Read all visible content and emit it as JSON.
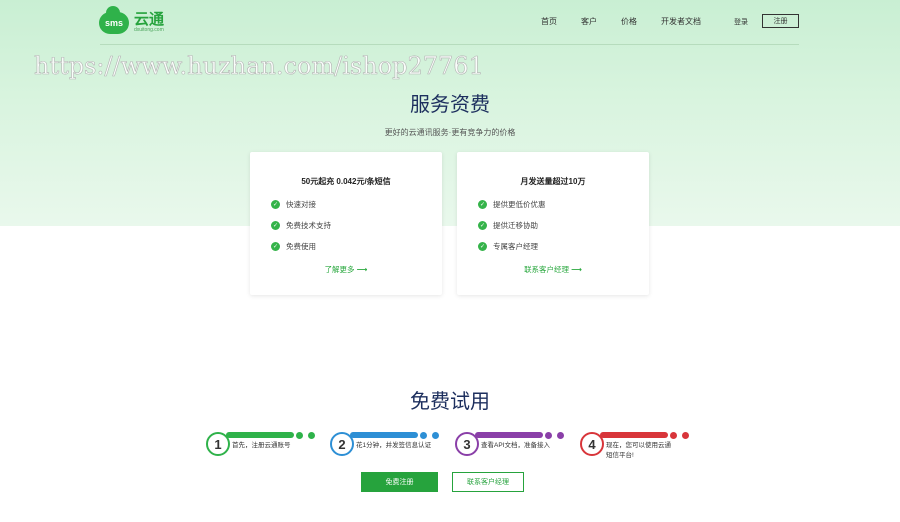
{
  "header": {
    "logo_badge": "sms",
    "logo_name": "云通",
    "logo_sub": "dxuitong.com",
    "nav": [
      "首页",
      "客户",
      "价格",
      "开发者文档"
    ],
    "login": "登录",
    "register": "注册"
  },
  "watermark": "https://www.huzhan.com/ishop27761",
  "pricing": {
    "title": "服务资费",
    "subtitle": "更好的云通讯服务·更有竞争力的价格",
    "cards": [
      {
        "title": "50元起充 0.042元/条短信",
        "features": [
          "快速对接",
          "免费技术支持",
          "免费使用"
        ],
        "link": "了解更多"
      },
      {
        "title": "月发送量超过10万",
        "features": [
          "提供更低价优惠",
          "提供迁移协助",
          "专属客户经理"
        ],
        "link": "联系客户经理"
      }
    ]
  },
  "trial": {
    "title": "免费试用",
    "steps": [
      {
        "num": "1",
        "text": "首先，注册云通账号",
        "color": "#2fb24a"
      },
      {
        "num": "2",
        "text": "花1分钟，并发签信息认证",
        "color": "#2d8fd5"
      },
      {
        "num": "3",
        "text": "查看API文档，准备接入",
        "color": "#8a3fa8"
      },
      {
        "num": "4",
        "text": "现在，您可以使用云通",
        "text2": "短信平台!",
        "color": "#d8353a"
      }
    ],
    "primary_button": "免费注册",
    "secondary_button": "联系客户经理"
  },
  "icons": {
    "check": "check-circle-icon",
    "arrow": "arrow-right-icon"
  },
  "colors": {
    "brand_green": "#26a33d",
    "title_navy": "#1d2f5e"
  }
}
